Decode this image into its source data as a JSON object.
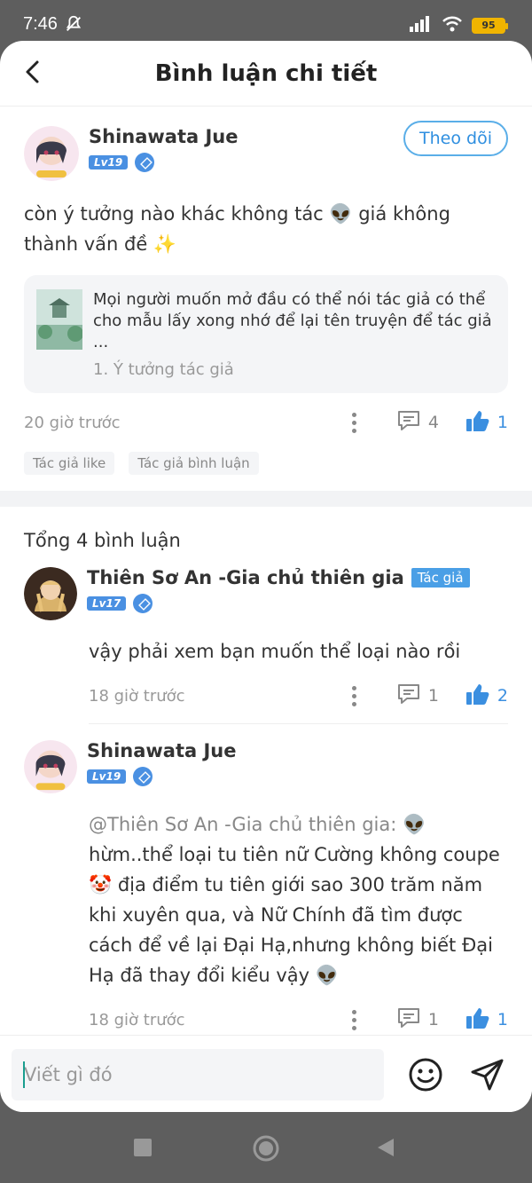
{
  "status_bar": {
    "time": "7:46",
    "battery": "95"
  },
  "header": {
    "title": "Bình luận chi tiết"
  },
  "main_comment": {
    "username": "Shinawata Jue",
    "level": "Lv19",
    "follow_label": "Theo dõi",
    "text": "còn ý tưởng nào khác không tác 👽 giá không thành vấn đề ✨",
    "quote": {
      "text": "Mọi người muốn mở đầu có thể nói tác giả có thể cho mẫu lấy xong nhớ để lại tên truyện để tác giả ...",
      "sub": "1. Ý tưởng tác giả"
    },
    "time": "20 giờ trước",
    "reply_count": "4",
    "like_count": "1",
    "tags": [
      "Tác giả like",
      "Tác giả bình luận"
    ]
  },
  "total_label": "Tổng 4 bình luận",
  "replies": [
    {
      "username": "Thiên Sơ An -Gia chủ thiên gia",
      "author_tag": "Tác giả",
      "level": "Lv17",
      "mention": "",
      "text": "vậy phải xem bạn muốn thể loại nào rồi",
      "time": "18 giờ trước",
      "reply_count": "1",
      "like_count": "2"
    },
    {
      "username": "Shinawata Jue",
      "level": "Lv19",
      "mention": "@Thiên Sơ An -Gia chủ thiên gia:",
      "text": " 👽 hừm..thể loại tu tiên nữ Cường không coupe 🤡 địa điểm tu tiên giới sao 300 trăm năm khi xuyên qua, và Nữ Chính đã tìm được cách để về lại Đại Hạ,nhưng không biết Đại Hạ đã thay đổi kiểu vậy 👽",
      "time": "18 giờ trước",
      "reply_count": "1",
      "like_count": "1"
    }
  ],
  "input": {
    "placeholder": "Viết gì đó"
  },
  "colors": {
    "accent": "#3b8fe0",
    "level_badge": "#4a90e2",
    "author_tag": "#4a9fe6"
  }
}
